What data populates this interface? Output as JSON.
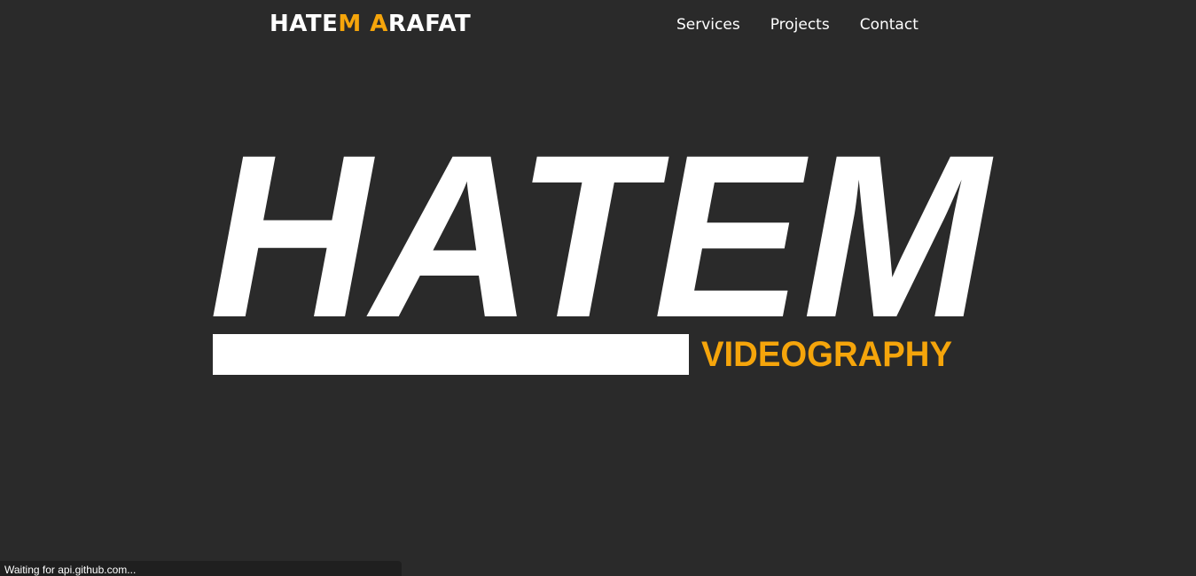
{
  "header": {
    "brand_part1": "HATE",
    "brand_part2": "M",
    "brand_part3": " ",
    "brand_part4": "A",
    "brand_part5": "RAFAT",
    "nav": [
      "Services",
      "Projects",
      "Contact"
    ]
  },
  "hero": {
    "title": "HATEM",
    "subtitle": "VIDEOGRAPHY"
  },
  "status": {
    "text": "Waiting for api.github.com..."
  },
  "colors": {
    "background": "#2a2a2a",
    "accent": "#f5a50b",
    "text": "#ffffff"
  }
}
